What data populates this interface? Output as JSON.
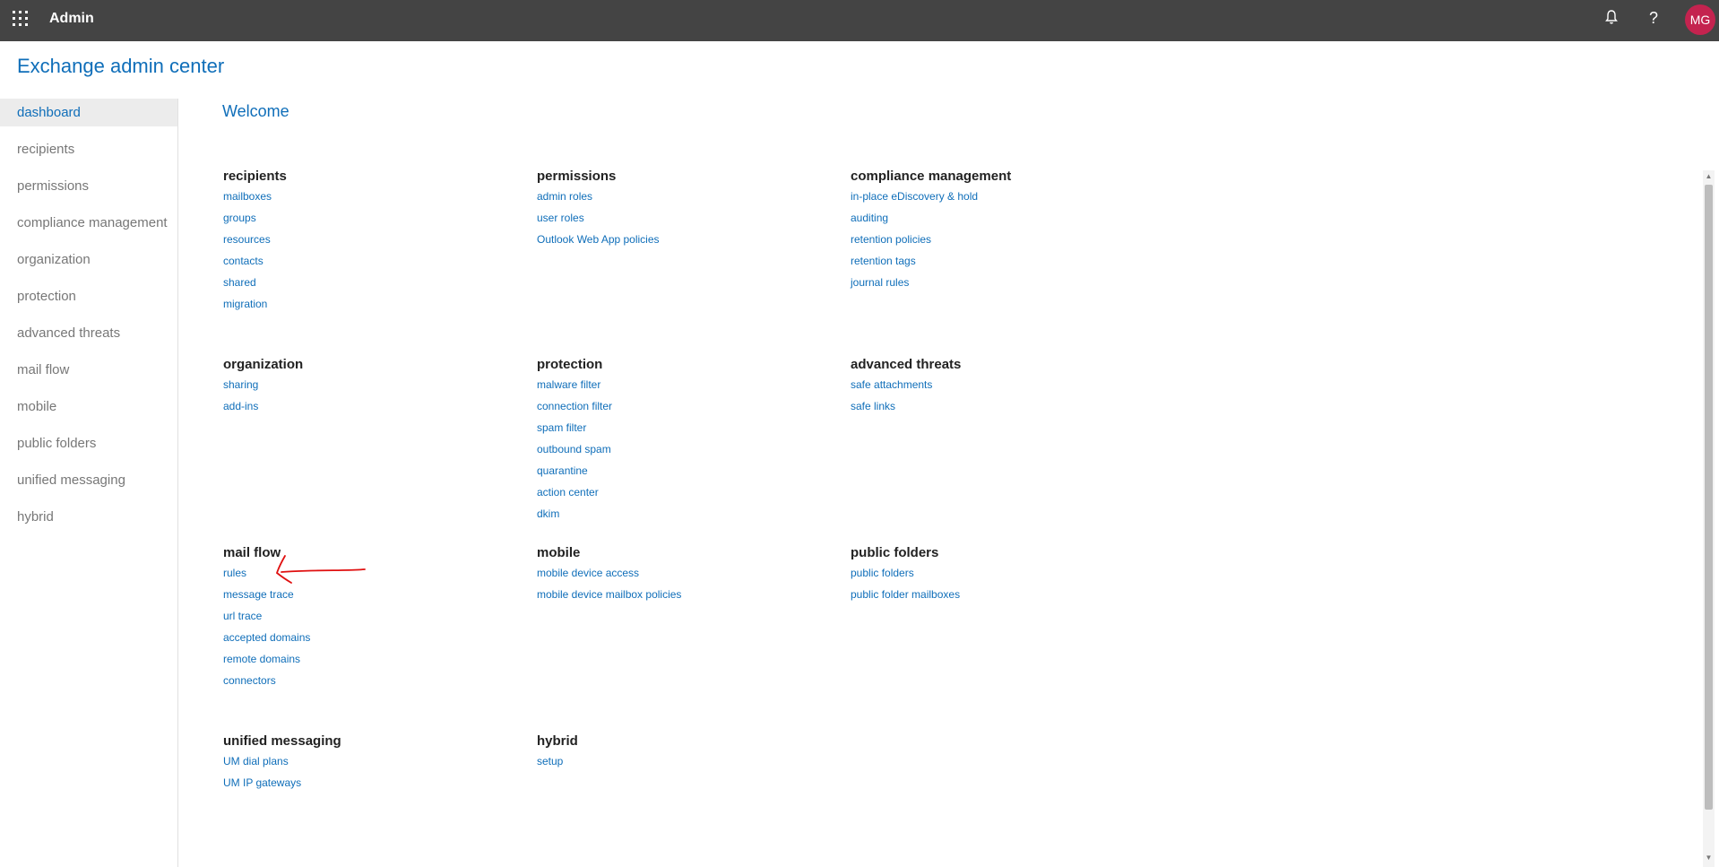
{
  "topbar": {
    "app_title": "Admin",
    "avatar_initials": "MG",
    "notification_icon": "bell-icon",
    "help_label": "?",
    "background": "#444444",
    "avatar_color": "#c4234f"
  },
  "page_title": "Exchange admin center",
  "leftnav": {
    "items": [
      {
        "label": "dashboard",
        "active": true
      },
      {
        "label": "recipients"
      },
      {
        "label": "permissions"
      },
      {
        "label": "compliance management"
      },
      {
        "label": "organization"
      },
      {
        "label": "protection"
      },
      {
        "label": "advanced threats"
      },
      {
        "label": "mail flow"
      },
      {
        "label": "mobile"
      },
      {
        "label": "public folders"
      },
      {
        "label": "unified messaging"
      },
      {
        "label": "hybrid"
      }
    ]
  },
  "main": {
    "welcome": "Welcome",
    "sections": [
      {
        "heading": "recipients",
        "links": [
          "mailboxes",
          "groups",
          "resources",
          "contacts",
          "shared",
          "migration"
        ]
      },
      {
        "heading": "permissions",
        "links": [
          "admin roles",
          "user roles",
          "Outlook Web App policies"
        ]
      },
      {
        "heading": "compliance management",
        "links": [
          "in-place eDiscovery & hold",
          "auditing",
          "retention policies",
          "retention tags",
          "journal rules"
        ]
      },
      {
        "heading": "organization",
        "links": [
          "sharing",
          "add-ins"
        ]
      },
      {
        "heading": "protection",
        "links": [
          "malware filter",
          "connection filter",
          "spam filter",
          "outbound spam",
          "quarantine",
          "action center",
          "dkim"
        ]
      },
      {
        "heading": "advanced threats",
        "links": [
          "safe attachments",
          "safe links"
        ]
      },
      {
        "heading": "mail flow",
        "links": [
          "rules",
          "message trace",
          "url trace",
          "accepted domains",
          "remote domains",
          "connectors"
        ]
      },
      {
        "heading": "mobile",
        "links": [
          "mobile device access",
          "mobile device mailbox policies"
        ]
      },
      {
        "heading": "public folders",
        "links": [
          "public folders",
          "public folder mailboxes"
        ]
      },
      {
        "heading": "unified messaging",
        "links": [
          "UM dial plans",
          "UM IP gateways"
        ]
      },
      {
        "heading": "hybrid",
        "links": [
          "setup"
        ]
      }
    ]
  },
  "colors": {
    "accent": "#0f6eb9",
    "annotation": "#e01010"
  }
}
